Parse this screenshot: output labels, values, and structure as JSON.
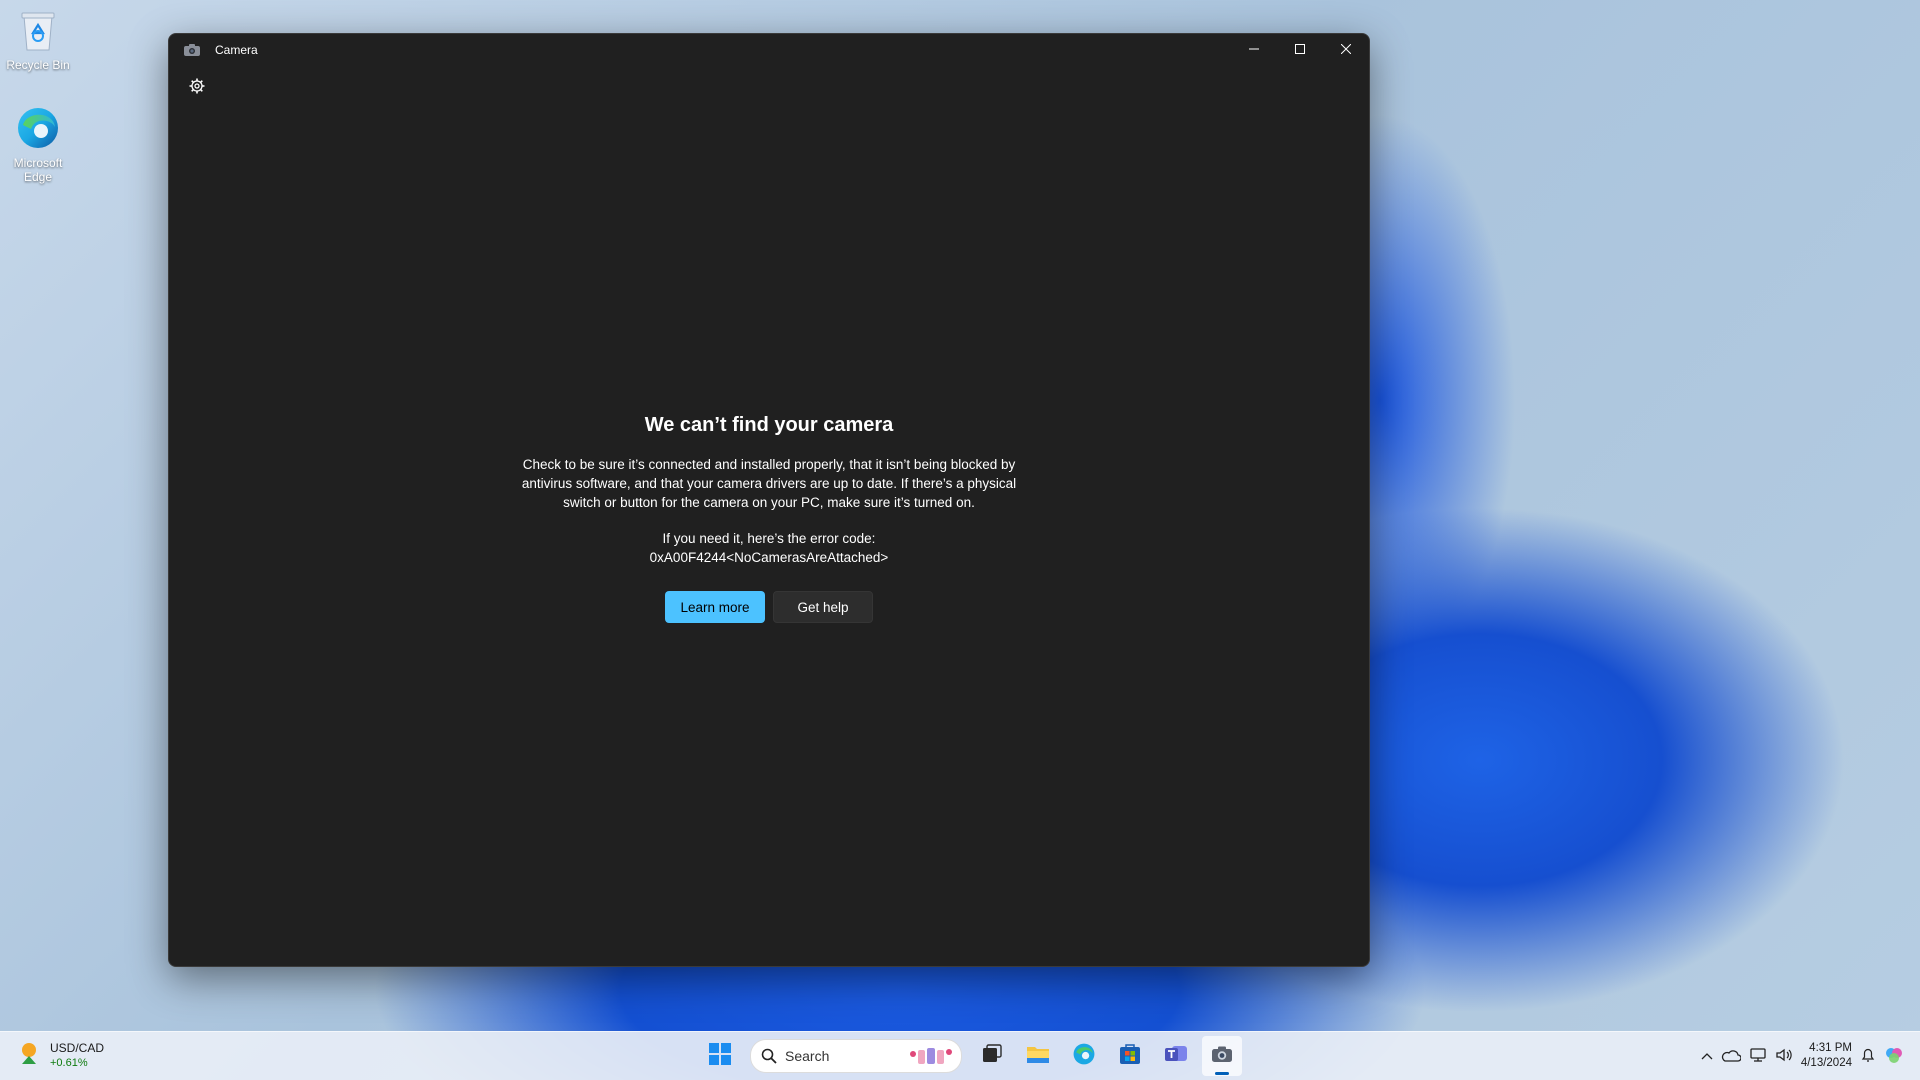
{
  "desktop": {
    "icons": [
      {
        "label": "Recycle Bin",
        "icon": "recycle-bin-icon"
      },
      {
        "label": "Microsoft Edge",
        "icon": "edge-icon"
      }
    ]
  },
  "window": {
    "title": "Camera",
    "app_icon": "camera-icon",
    "controls": [
      "minimize-icon",
      "maximize-icon",
      "close-icon"
    ]
  },
  "error": {
    "heading": "We can’t find your camera",
    "description": "Check to be sure it’s connected and installed properly, that it isn’t being blocked by antivirus software, and that your camera drivers are up to date. If there’s a physical switch or button for the camera on your PC, make sure it’s turned on.",
    "code_intro": "If you need it, here’s the error code:",
    "code": "0xA00F4244<NoCamerasAreAttached>",
    "learn_more_label": "Learn more",
    "get_help_label": "Get help"
  },
  "taskbar": {
    "widget": {
      "title": "USD/CAD",
      "change": "+0.61%"
    },
    "search_placeholder": "Search",
    "apps": [
      "start-icon",
      "task-view-icon",
      "file-explorer-icon",
      "edge-icon",
      "store-icon",
      "teams-icon",
      "camera-icon"
    ],
    "clock": {
      "time": "4:31 PM",
      "date": "4/13/2024"
    }
  },
  "colors": {
    "window_bg": "#202020",
    "accent_button": "#4cc2ff",
    "positive_change": "#0f7b0f"
  }
}
